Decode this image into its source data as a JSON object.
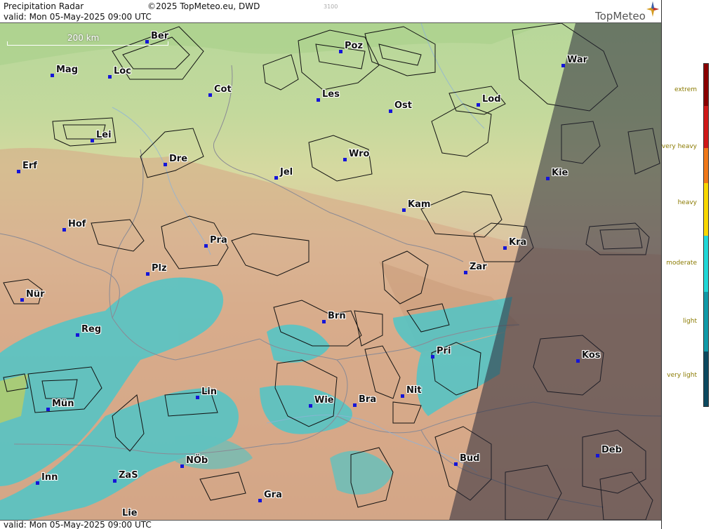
{
  "header": {
    "title": "Precipitation Radar",
    "copyright": "©2025 TopMeteo.eu, DWD",
    "valid": "valid:  Mon  05-May-2025 09:00 UTC",
    "code": "3100",
    "brand": "TopMeteo"
  },
  "footer": {
    "valid": "valid:  Mon  05-May-2025 09:00 UTC"
  },
  "scale": {
    "label": "200 km"
  },
  "cities": [
    {
      "key": "ber",
      "label": "Ber"
    },
    {
      "key": "poz",
      "label": "Poz"
    },
    {
      "key": "war",
      "label": "War"
    },
    {
      "key": "mag",
      "label": "Mag"
    },
    {
      "key": "loc",
      "label": "Loc"
    },
    {
      "key": "cot",
      "label": "Cot"
    },
    {
      "key": "les",
      "label": "Les"
    },
    {
      "key": "ost",
      "label": "Ost"
    },
    {
      "key": "lod",
      "label": "Lod"
    },
    {
      "key": "lei",
      "label": "Lei"
    },
    {
      "key": "dre",
      "label": "Dre"
    },
    {
      "key": "wro",
      "label": "Wro"
    },
    {
      "key": "erf",
      "label": "Erf"
    },
    {
      "key": "jel",
      "label": "Jel"
    },
    {
      "key": "kie",
      "label": "Kie"
    },
    {
      "key": "kam",
      "label": "Kam"
    },
    {
      "key": "hof",
      "label": "Hof"
    },
    {
      "key": "pra",
      "label": "Pra"
    },
    {
      "key": "kra",
      "label": "Kra"
    },
    {
      "key": "plz",
      "label": "Plz"
    },
    {
      "key": "zar",
      "label": "Zar"
    },
    {
      "key": "nur",
      "label": "Nür"
    },
    {
      "key": "brn",
      "label": "Brn"
    },
    {
      "key": "reg",
      "label": "Reg"
    },
    {
      "key": "pri",
      "label": "Pri"
    },
    {
      "key": "kos",
      "label": "Kos"
    },
    {
      "key": "lin",
      "label": "Lin"
    },
    {
      "key": "nit",
      "label": "Nit"
    },
    {
      "key": "wie",
      "label": "Wie"
    },
    {
      "key": "bra",
      "label": "Bra"
    },
    {
      "key": "mun",
      "label": "Mün"
    },
    {
      "key": "deb",
      "label": "Deb"
    },
    {
      "key": "bud",
      "label": "Bud"
    },
    {
      "key": "nob",
      "label": "NÖb"
    },
    {
      "key": "inn",
      "label": "Inn"
    },
    {
      "key": "zas",
      "label": "ZaS"
    },
    {
      "key": "gra",
      "label": "Gra"
    },
    {
      "key": "lie",
      "label": "Lie"
    }
  ],
  "legend": {
    "labels": [
      "extrem",
      "very heavy",
      "heavy",
      "moderate",
      "light",
      "very light"
    ],
    "colors": [
      "#8b0000",
      "#d01818",
      "#f07818",
      "#f8d800",
      "#20d8d8",
      "#109aa8",
      "#0c4a60"
    ]
  }
}
